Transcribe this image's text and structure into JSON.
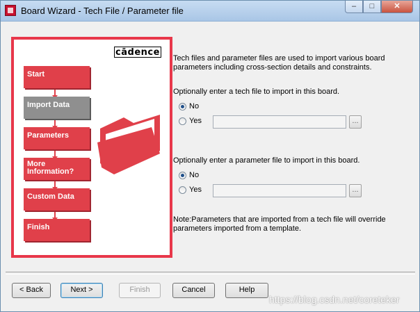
{
  "window": {
    "title": "Board Wizard - Tech File / Parameter file"
  },
  "titlebar_buttons": {
    "minimize": "–",
    "maximize": "□",
    "close": "✕"
  },
  "sidebar": {
    "logo": "cādence",
    "steps": [
      {
        "label": "Start",
        "active": false
      },
      {
        "label": "Import Data",
        "active": true
      },
      {
        "label": "Parameters",
        "active": false
      },
      {
        "label": "More Information?",
        "active": false
      },
      {
        "label": "Custom Data",
        "active": false
      },
      {
        "label": "Finish",
        "active": false
      }
    ]
  },
  "main": {
    "intro": "Tech files and parameter files are used to import various board parameters including cross-section details and constraints.",
    "techfile": {
      "prompt": "Optionally enter a tech file to import in this board.",
      "option_no": "No",
      "option_yes": "Yes",
      "selected": "No",
      "value": "",
      "browse_label": "..."
    },
    "paramfile": {
      "prompt": "Optionally enter a parameter file to import in this board.",
      "option_no": "No",
      "option_yes": "Yes",
      "selected": "No",
      "value": "",
      "browse_label": "..."
    },
    "note": "Note:Parameters that are imported from a tech file will override parameters imported from a template."
  },
  "buttons": {
    "back": "< Back",
    "next": "Next >",
    "finish": "Finish",
    "cancel": "Cancel",
    "help": "Help"
  },
  "watermark": "https://blog.csdn.net/coreteker",
  "colors": {
    "accent_red": "#e0404a",
    "active_gray": "#8f8f8f"
  }
}
